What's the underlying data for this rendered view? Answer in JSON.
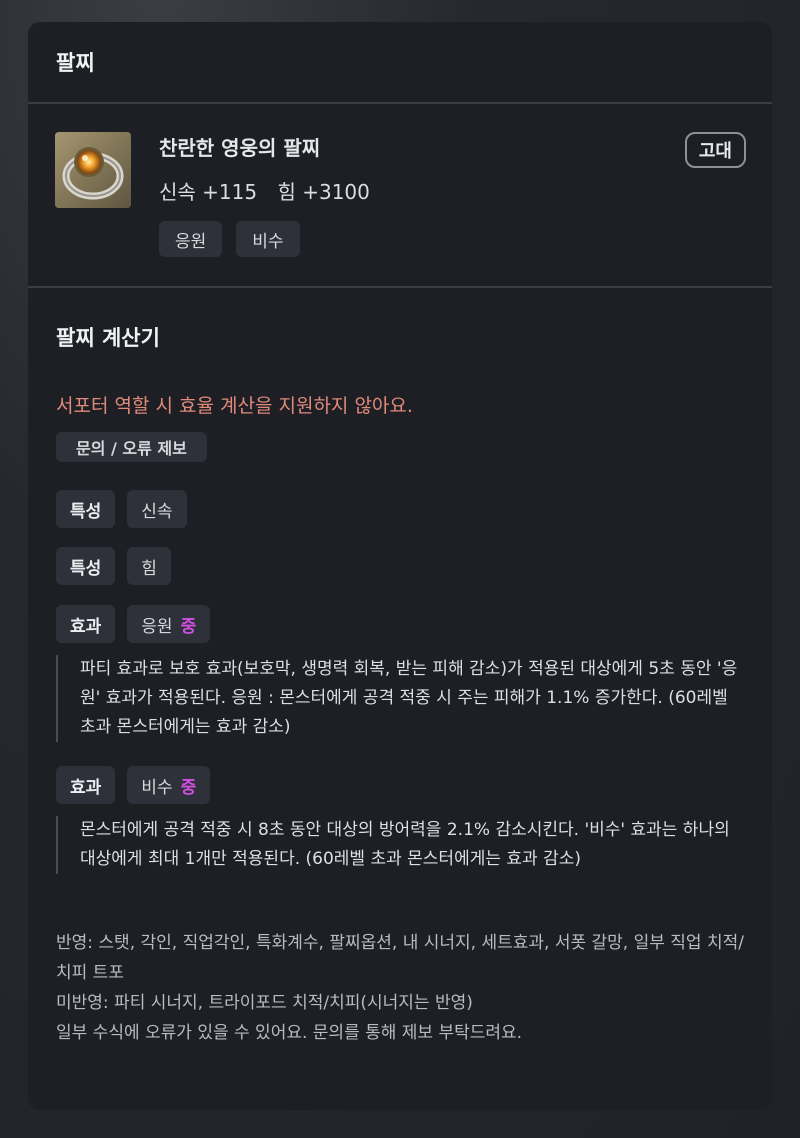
{
  "header": {
    "title": "팔찌"
  },
  "item": {
    "name": "찬란한 영웅의 팔찌",
    "grade": "고대",
    "stats": [
      "신속 +115",
      "힘 +3100"
    ],
    "tags": [
      "응원",
      "비수"
    ],
    "icon": "bracelet-icon"
  },
  "calculator": {
    "title": "팔찌 계산기",
    "warning": "서포터 역할 시 효율 계산을 지원하지 않아요.",
    "report_button": "문의 / 오류 제보",
    "traits": [
      {
        "label": "특성",
        "value": "신속"
      },
      {
        "label": "특성",
        "value": "힘"
      }
    ],
    "effects": [
      {
        "label": "효과",
        "value": "응원",
        "grade": "중",
        "description": "파티 효과로 보호 효과(보호막, 생명력 회복, 받는 피해 감소)가 적용된 대상에게 5초 동안 '응원' 효과가 적용된다. 응원 : 몬스터에게 공격 적중 시 주는 피해가 1.1% 증가한다. (60레벨 초과 몬스터에게는 효과 감소)"
      },
      {
        "label": "효과",
        "value": "비수",
        "grade": "중",
        "description": "몬스터에게 공격 적중 시 8초 동안 대상의 방어력을 2.1% 감소시킨다. '비수' 효과는 하나의 대상에게 최대 1개만 적용된다. (60레벨 초과 몬스터에게는 효과 감소)"
      }
    ],
    "footer": [
      "반영: 스탯, 각인, 직업각인, 특화계수, 팔찌옵션, 내 시너지, 세트효과, 서폿 갈망, 일부 직업 치적/치피 트포",
      "미반영: 파티 시너지, 트라이포드 치적/치피(시너지는 반영)",
      "일부 수식에 오류가 있을 수 있어요. 문의를 통해 제보 부탁드려요."
    ]
  },
  "colors": {
    "warning": "#e08a7a",
    "grade_mid": "#d24ee0",
    "panel": "#1d1f25"
  }
}
